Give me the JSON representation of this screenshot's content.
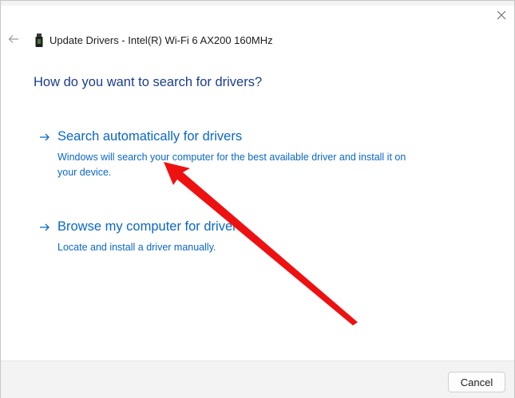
{
  "window": {
    "title": "Update Drivers - Intel(R) Wi-Fi 6 AX200 160MHz",
    "icons": {
      "back": "back-arrow-icon",
      "close": "close-icon",
      "device": "network-adapter-icon"
    }
  },
  "main": {
    "heading": "How do you want to search for drivers?",
    "options": [
      {
        "title": "Search automatically for drivers",
        "description": "Windows will search your computer for the best available driver and install it on your device."
      },
      {
        "title": "Browse my computer for drivers",
        "description": "Locate and install a driver manually."
      }
    ]
  },
  "footer": {
    "cancel_label": "Cancel"
  },
  "colors": {
    "link": "#0a67c8",
    "heading": "#1a3d8f",
    "annotation_arrow": "#ee1111",
    "footer_bg": "#f3f3f3"
  }
}
